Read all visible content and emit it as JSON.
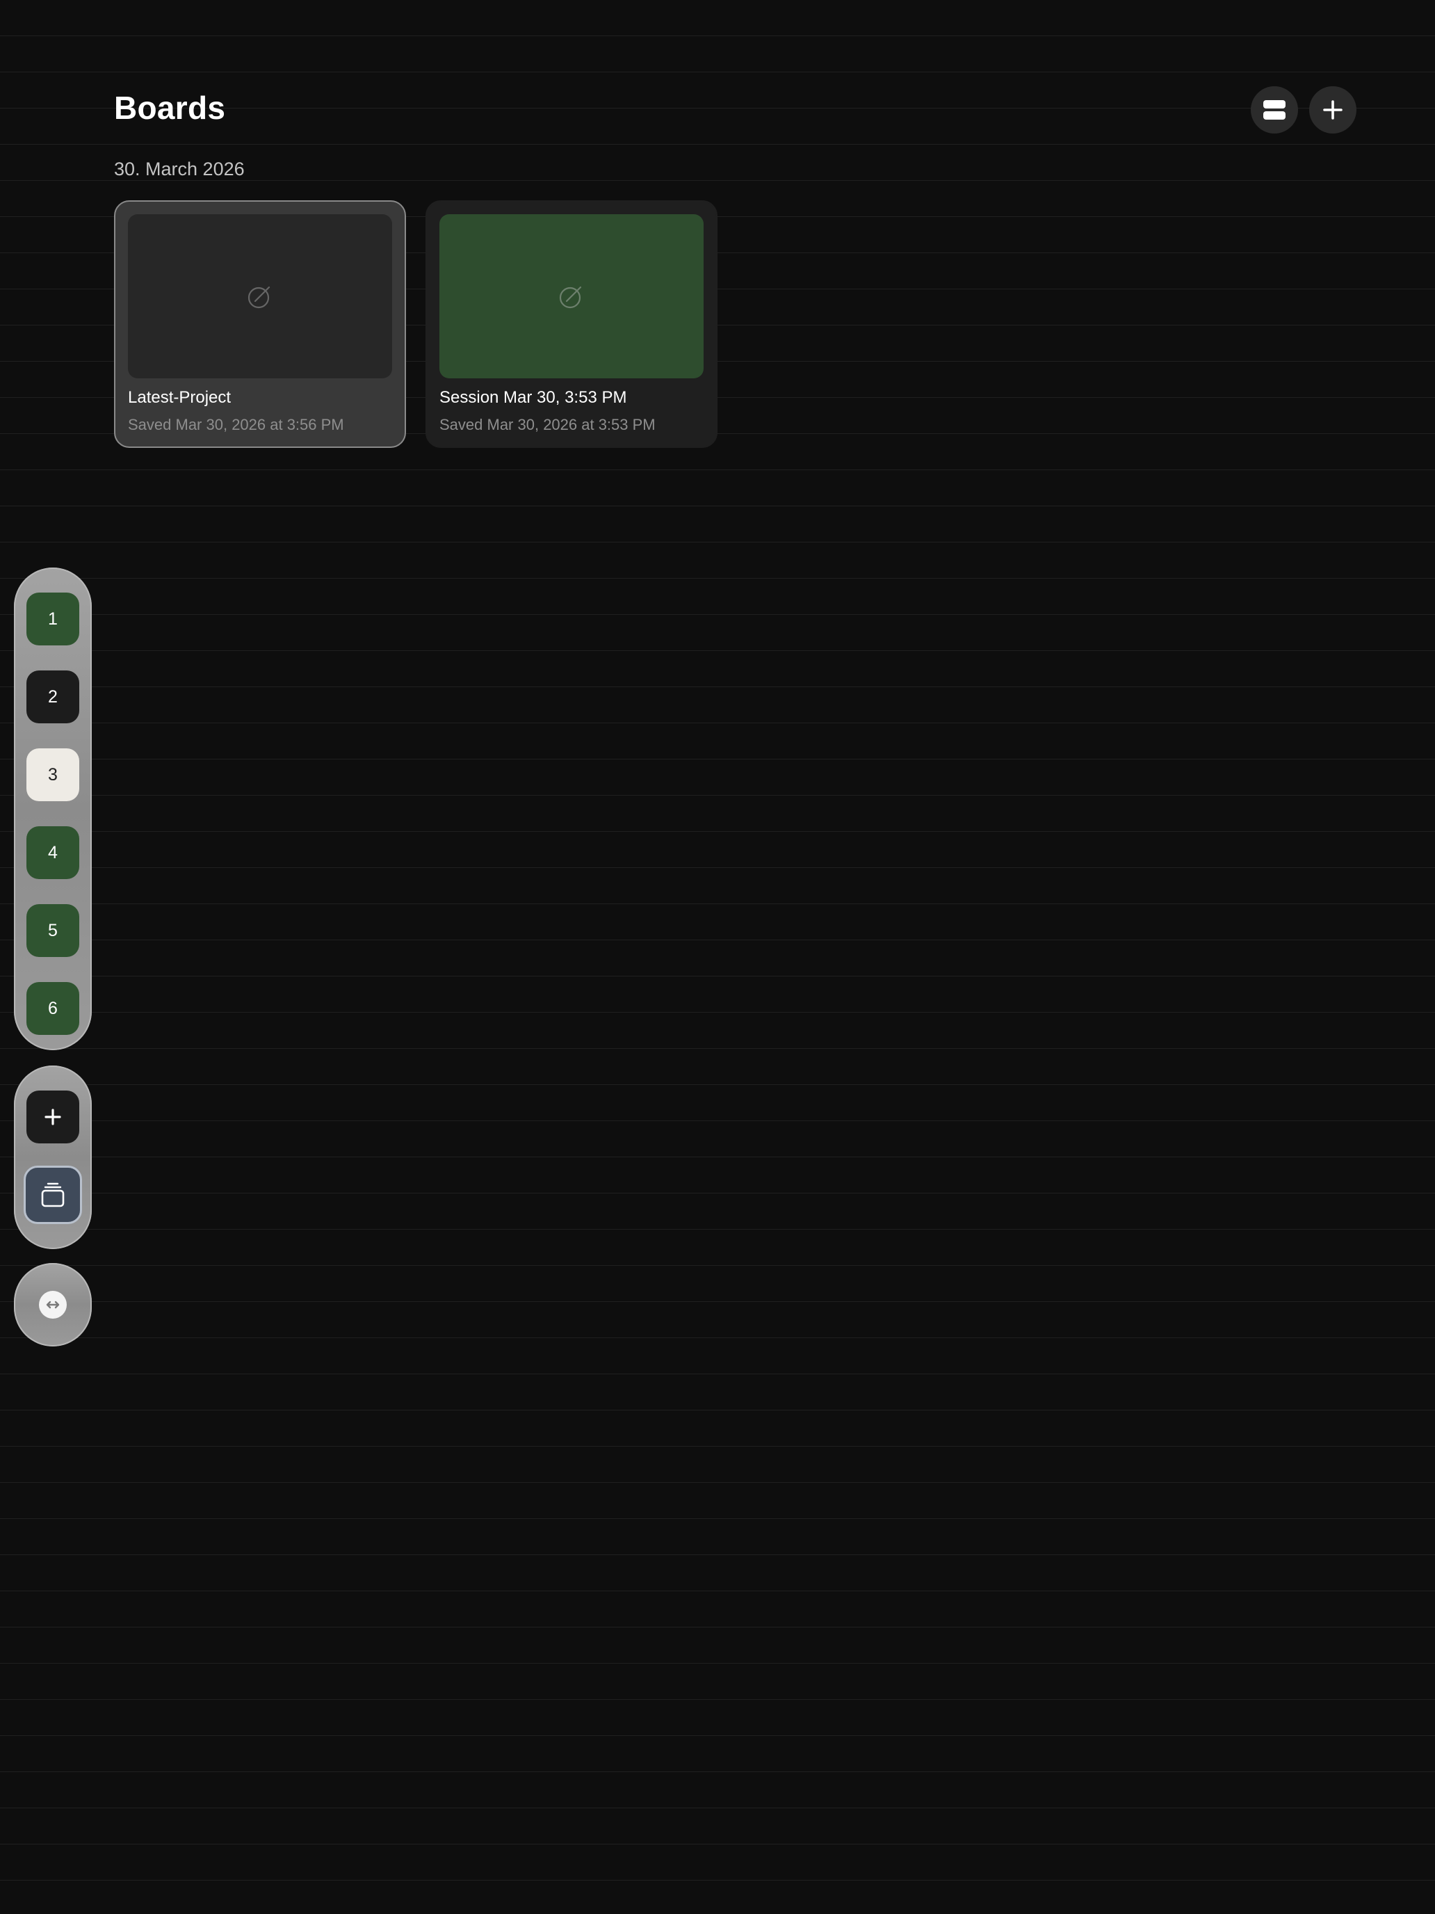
{
  "header": {
    "title": "Boards",
    "layout_toggle_icon": "rows-icon",
    "new_board_icon": "plus-icon"
  },
  "sections": [
    {
      "date": "30. March 2026",
      "boards": [
        {
          "name": "Latest-Project",
          "saved": "Saved Mar 30, 2026 at 3:56 PM",
          "thumbnail_color": "#272727",
          "thumbnail_icon": "no-preview-icon",
          "selected": true
        },
        {
          "name": "Session Mar 30, 3:53 PM",
          "saved": "Saved Mar 30, 2026 at 3:53 PM",
          "thumbnail_color": "#2e4d2e",
          "thumbnail_icon": "no-preview-icon",
          "selected": false
        }
      ]
    }
  ],
  "page_rail": {
    "pages": [
      {
        "label": "1",
        "color": "#2f5430"
      },
      {
        "label": "2",
        "color": "#1c1c1c"
      },
      {
        "label": "3",
        "color": "#eeebe5"
      },
      {
        "label": "4",
        "color": "#2f5430"
      },
      {
        "label": "5",
        "color": "#2f5430"
      },
      {
        "label": "6",
        "color": "#2f5430"
      }
    ]
  },
  "action_rail": {
    "add_icon": "plus-icon",
    "boards_icon": "stack-icon"
  },
  "swap_control": {
    "icon": "swap-horizontal-icon"
  }
}
